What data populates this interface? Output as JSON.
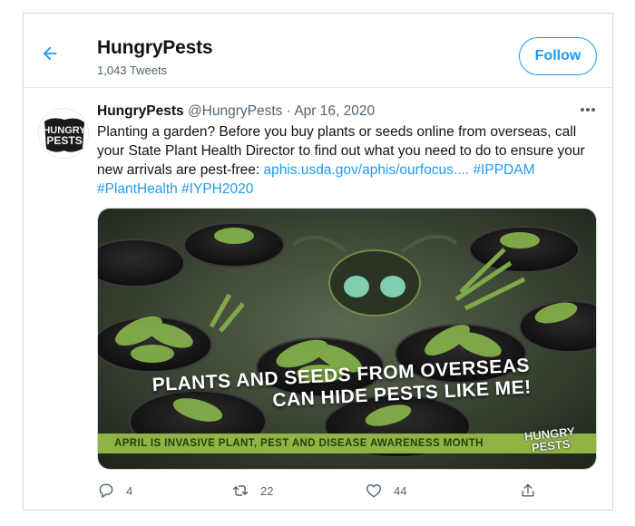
{
  "header": {
    "title": "HungryPests",
    "tweet_count": "1,043 Tweets",
    "follow_label": "Follow"
  },
  "tweet": {
    "author_name": "HungryPests",
    "handle": "@HungryPests",
    "separator": "·",
    "date": "Apr 16, 2020",
    "text_main": "Planting a garden? Before you buy plants or seeds online from overseas, call your State Plant Health Director to find out what you need to do to ensure your new arrivals are pest-free: ",
    "link_url": "aphis.usda.gov/aphis/ourfocus....",
    "hashtag_1": "#IPPDAM",
    "hashtag_2": "#PlantHealth",
    "hashtag_3": "#IYPH2020",
    "avatar_text_1": "HUNGRY",
    "avatar_text_2": "PESTS"
  },
  "media": {
    "caption_line1": "PLANTS AND SEEDS FROM OVERSEAS",
    "caption_line2": "CAN HIDE PESTS LIKE ME!",
    "banner": "APRIL IS INVASIVE PLANT, PEST AND DISEASE AWARENESS MONTH",
    "logo_line1": "HUNGRY",
    "logo_line2": "PESTS"
  },
  "actions": {
    "reply_count": "4",
    "retweet_count": "22",
    "like_count": "44"
  },
  "icons": {
    "back": "arrow-left-icon",
    "more": "more-horizontal-icon",
    "reply": "reply-icon",
    "retweet": "retweet-icon",
    "like": "heart-icon",
    "share": "share-icon"
  },
  "colors": {
    "accent": "#1d9bf0",
    "text_primary": "#0f1419",
    "text_secondary": "#536471",
    "banner_green": "#8fb443"
  }
}
